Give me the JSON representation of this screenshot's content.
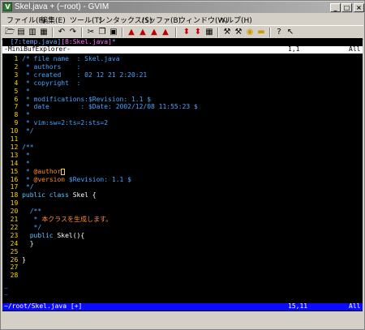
{
  "window": {
    "title": "Skel.java + (~root) - GVIM",
    "app_icon_letter": "V",
    "buttons": {
      "minimize": "_",
      "maximize": "□",
      "close": "×"
    }
  },
  "menu": [
    "ファイル(F)",
    "編集(E)",
    "ツール(T)",
    "シンタックス(S)",
    "バッファ(B)",
    "ウィンドウ(W)",
    "ヘルプ(H)"
  ],
  "toolbar": {
    "icons": [
      "open-icon",
      "save-icon",
      "save-all-icon",
      "print-icon",
      "undo-icon",
      "redo-icon",
      "cut-icon",
      "copy-icon",
      "paste-icon",
      "find-replace-icon",
      "find-next-icon",
      "find-prev-icon",
      "load-session-icon",
      "save-session-icon",
      "run-script-icon",
      "make-icon",
      "run-ctags-icon",
      "jump-to-tag-icon",
      "help-icon",
      "find-help-icon"
    ]
  },
  "editor": {
    "tabline": {
      "prefix": "  ",
      "other": "[7:temp.java]",
      "current": "[8:Skel.java]",
      "suffix": "*"
    },
    "minibuf_status": {
      "name": "-MiniBufExplorer-",
      "pos": "1,1",
      "pct": "All"
    },
    "lines": [
      {
        "no": "1",
        "parts": [
          {
            "t": "/* file name  : Skel.java",
            "c": "cmt"
          }
        ]
      },
      {
        "no": "2",
        "parts": [
          {
            "t": " * authors    :",
            "c": "cmt"
          }
        ]
      },
      {
        "no": "3",
        "parts": [
          {
            "t": " * created    : 02 12 21 2:20:21",
            "c": "cmt"
          }
        ]
      },
      {
        "no": "4",
        "parts": [
          {
            "t": " * copyright  :",
            "c": "cmt"
          }
        ]
      },
      {
        "no": "5",
        "parts": [
          {
            "t": " *",
            "c": "cmt"
          }
        ]
      },
      {
        "no": "6",
        "parts": [
          {
            "t": " * modifications:$Revision: 1.1 $",
            "c": "cmt"
          }
        ]
      },
      {
        "no": "7",
        "parts": [
          {
            "t": " * date        : $Date: 2002/12/08 11:55:23 $",
            "c": "cmt"
          }
        ]
      },
      {
        "no": "8",
        "parts": [
          {
            "t": " *",
            "c": "cmt"
          }
        ]
      },
      {
        "no": "9",
        "parts": [
          {
            "t": " * vim:sw=2:ts=2:sts=2",
            "c": "cmt"
          }
        ]
      },
      {
        "no": "10",
        "parts": [
          {
            "t": " */",
            "c": "cmt"
          }
        ]
      },
      {
        "no": "11",
        "parts": []
      },
      {
        "no": "12",
        "parts": [
          {
            "t": "/**",
            "c": "cmt"
          }
        ]
      },
      {
        "no": "13",
        "parts": [
          {
            "t": " *",
            "c": "cmt"
          }
        ]
      },
      {
        "no": "14",
        "parts": [
          {
            "t": " *",
            "c": "cmt"
          }
        ]
      },
      {
        "no": "15",
        "parts": [
          {
            "t": " * ",
            "c": "cmt"
          },
          {
            "t": "@author",
            "c": "tag"
          },
          {
            "t": "",
            "c": "cursor"
          }
        ]
      },
      {
        "no": "16",
        "parts": [
          {
            "t": " * ",
            "c": "cmt"
          },
          {
            "t": "@version",
            "c": "tag"
          },
          {
            "t": " $Revision: 1.1 $",
            "c": "cmt"
          }
        ]
      },
      {
        "no": "17",
        "parts": [
          {
            "t": " */",
            "c": "cmt"
          }
        ]
      },
      {
        "no": "18",
        "parts": [
          {
            "t": "public class",
            "c": "kw"
          },
          {
            "t": " Skel {",
            "c": "plain"
          }
        ]
      },
      {
        "no": "19",
        "parts": []
      },
      {
        "no": "20",
        "parts": [
          {
            "t": "  /**",
            "c": "cmt"
          }
        ]
      },
      {
        "no": "21",
        "parts": [
          {
            "t": "   * ",
            "c": "cmt"
          },
          {
            "t": "本クラスを生成します。",
            "c": "jp"
          }
        ]
      },
      {
        "no": "22",
        "parts": [
          {
            "t": "   */",
            "c": "cmt"
          }
        ]
      },
      {
        "no": "23",
        "parts": [
          {
            "t": "  public",
            "c": "kw"
          },
          {
            "t": " Skel(){",
            "c": "plain"
          }
        ]
      },
      {
        "no": "24",
        "parts": [
          {
            "t": "  }",
            "c": "plain"
          }
        ]
      },
      {
        "no": "25",
        "parts": []
      },
      {
        "no": "26",
        "parts": [
          {
            "t": "}",
            "c": "plain"
          }
        ]
      },
      {
        "no": "27",
        "parts": []
      },
      {
        "no": "28",
        "parts": []
      }
    ],
    "tilde": "~",
    "status": {
      "file": "~/root/Skel.java [+]",
      "pos": "15,11",
      "pct": "All"
    }
  }
}
